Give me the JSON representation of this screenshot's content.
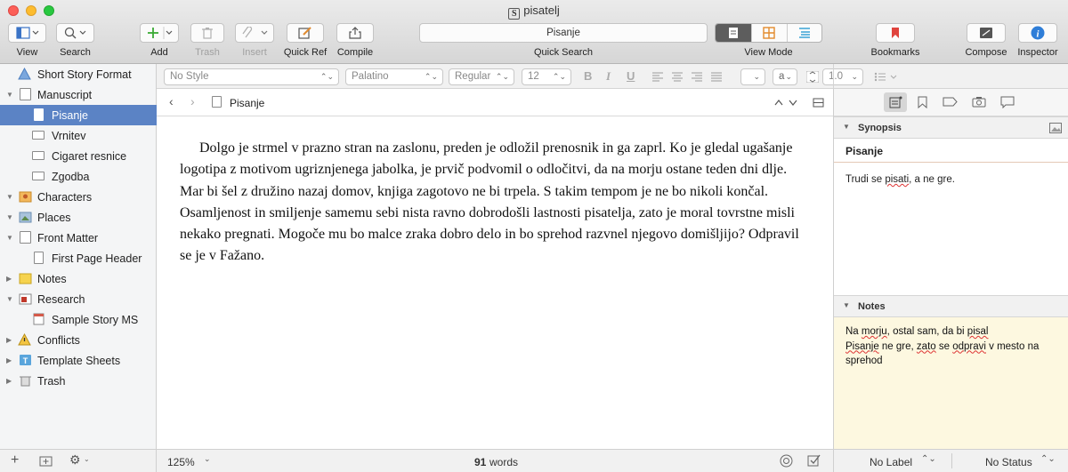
{
  "window": {
    "title": "pisatelj"
  },
  "toolbar": {
    "view": "View",
    "search": "Search",
    "add": "Add",
    "trash": "Trash",
    "insert": "Insert",
    "quick_ref": "Quick Ref",
    "compile": "Compile",
    "quick_search_value": "Pisanje",
    "quick_search_label": "Quick Search",
    "view_mode": "View Mode",
    "bookmarks": "Bookmarks",
    "compose": "Compose",
    "inspector": "Inspector"
  },
  "binder": {
    "items": [
      {
        "label": "Short Story Format",
        "icon": "warning-icon"
      },
      {
        "label": "Manuscript",
        "icon": "manuscript-icon"
      },
      {
        "label": "Pisanje",
        "icon": "document-icon"
      },
      {
        "label": "Vrnitev",
        "icon": "document-icon"
      },
      {
        "label": "Cigaret resnice",
        "icon": "document-icon"
      },
      {
        "label": "Zgodba",
        "icon": "document-icon"
      },
      {
        "label": "Characters",
        "icon": "characters-folder-icon"
      },
      {
        "label": "Places",
        "icon": "places-folder-icon"
      },
      {
        "label": "Front Matter",
        "icon": "front-matter-icon"
      },
      {
        "label": "First Page Header",
        "icon": "document-icon"
      },
      {
        "label": "Notes",
        "icon": "folder-icon"
      },
      {
        "label": "Research",
        "icon": "research-folder-icon"
      },
      {
        "label": "Sample Story MS",
        "icon": "document-icon"
      },
      {
        "label": "Conflicts",
        "icon": "warning-icon"
      },
      {
        "label": "Template Sheets",
        "icon": "template-icon"
      },
      {
        "label": "Trash",
        "icon": "trash-icon"
      }
    ]
  },
  "format": {
    "style": "No Style",
    "font": "Palatino",
    "weight": "Regular",
    "size": "12",
    "bold": "B",
    "italic": "I",
    "underline": "U",
    "char": "a",
    "line_spacing": "1.0"
  },
  "editor": {
    "doc_title": "Pisanje",
    "text": "Dolgo je strmel v prazno stran na zaslonu, preden je odložil prenosnik in ga zaprl. Ko je gledal ugašanje logotipa z motivom ugriznjenega jabolka, je prvič podvomil o odločitvi, da na morju ostane teden dni dlje. Mar bi šel z družino nazaj domov, knjiga zagotovo ne bi trpela. S takim tempom je ne bo nikoli končal. Osamljenost in smiljenje samemu sebi nista ravno dobrodošli lastnosti pisatelja, zato je moral tovrstne misli nekako pregnati. Mogoče mu bo malce zraka dobro delo in bo sprehod razvnel njegovo domišljijo? Odpravil se je v Fažano.",
    "zoom": "125%",
    "word_count": "91",
    "words_label": "words"
  },
  "inspector": {
    "synopsis_header": "Synopsis",
    "synopsis_title": "Pisanje",
    "synopsis_pre": "Trudi se ",
    "synopsis_wavy": "pisati",
    "synopsis_post": ", a ne gre.",
    "notes_header": "Notes",
    "note1_a": "Na ",
    "note1_b": "morju",
    "note1_c": ", ",
    "note1_d": "ostal sam, da bi ",
    "note1_e": "pisal",
    "note2_a": "Pisanje",
    "note2_b": " ne gre, ",
    "note2_c": "zato",
    "note2_d": " se ",
    "note2_e": "odpravi",
    "note2_f": " v mesto na sprehod",
    "label": "No Label",
    "status": "No Status"
  },
  "colors": {
    "selection": "#5b83c5",
    "notes_bg": "#fdf8e0",
    "view_active": "#5d5d5d",
    "bookmark": "#e0443e"
  }
}
